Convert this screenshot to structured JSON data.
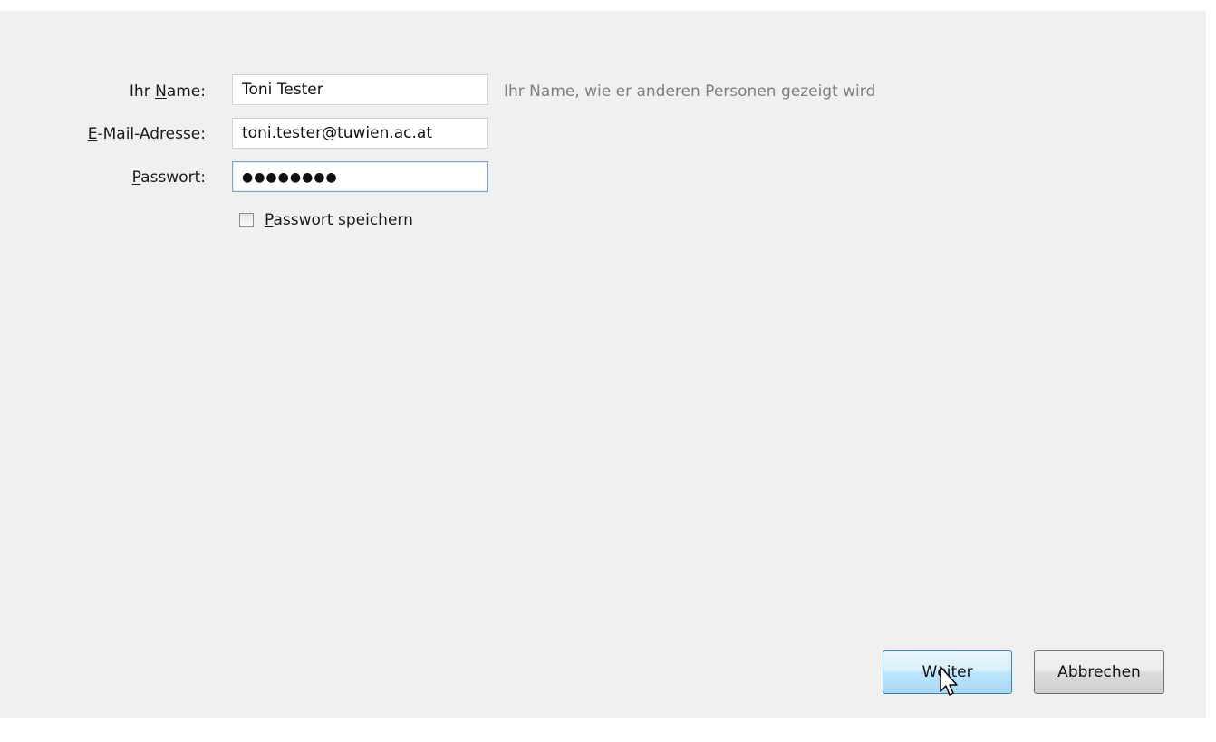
{
  "form": {
    "name": {
      "label_prefix": "Ihr ",
      "label_accesskey": "N",
      "label_suffix": "ame:",
      "value": "Toni Tester",
      "hint": "Ihr Name, wie er anderen Personen gezeigt wird"
    },
    "email": {
      "label_accesskey": "E",
      "label_suffix": "-Mail-Adresse:",
      "value": "toni.tester@tuwien.ac.at"
    },
    "password": {
      "label_accesskey": "P",
      "label_suffix": "asswort:",
      "masked_value": "●●●●●●●●"
    },
    "remember_password": {
      "label_accesskey": "P",
      "label_suffix": "asswort speichern",
      "checked": false
    }
  },
  "buttons": {
    "next": {
      "label_prefix": "W",
      "label_accesskey": "e",
      "label_suffix": "iter"
    },
    "cancel": {
      "label_accesskey": "A",
      "label_suffix": "bbrechen"
    }
  },
  "colors": {
    "dialog_background": "#f0f0f0",
    "hint_text": "#7f7f7f",
    "primary_button_border": "#3c7fb1",
    "focus_border": "#7aa6d6"
  },
  "icons": {
    "cursor": "mouse-pointer-icon"
  }
}
